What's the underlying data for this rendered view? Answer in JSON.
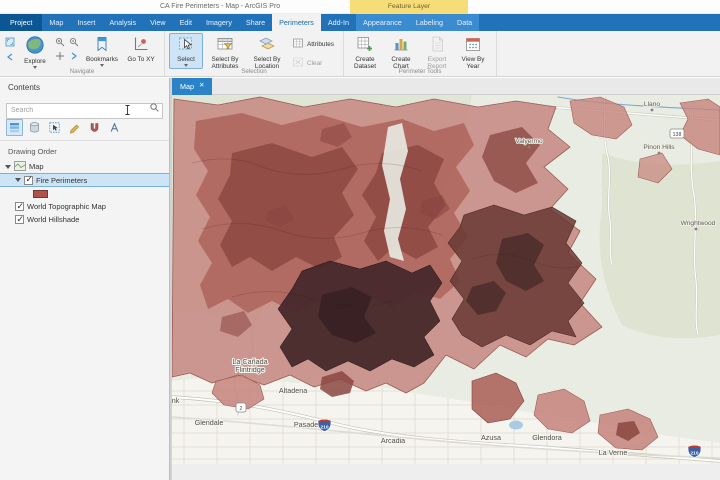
{
  "window": {
    "title": "CA Fire Perimeters - Map - ArcGIS Pro",
    "contextual_group": "Feature Layer"
  },
  "tabs": {
    "items": [
      "Project",
      "Map",
      "Insert",
      "Analysis",
      "View",
      "Edit",
      "Imagery",
      "Share",
      "Perimeters",
      "Add-In",
      "Appearance",
      "Labeling",
      "Data"
    ],
    "active": "Perimeters"
  },
  "ribbon": {
    "navigate": {
      "label": "Navigate",
      "explore": "Explore",
      "bookmarks": "Bookmarks",
      "go_to_xy": "Go To XY"
    },
    "selection": {
      "label": "Selection",
      "select": "Select",
      "select_by_attributes": "Select By Attributes",
      "select_by_location": "Select By Location",
      "attributes": "Attributes",
      "clear": "Clear"
    },
    "perimeter_tools": {
      "label": "Perimeter Tools",
      "create_dataset": "Create Dataset",
      "create_chart": "Create Chart",
      "export_report": "Export Report",
      "view_by_year": "View By Year"
    }
  },
  "contents": {
    "title": "Contents",
    "search_placeholder": "Search",
    "drawing_order": "Drawing Order",
    "map_node": "Map",
    "layers": [
      "Fire Perimeters",
      "World Topographic Map",
      "World Hillshade"
    ]
  },
  "mapview": {
    "tab": "Map",
    "close_glyph": "✕",
    "places": [
      "Llano",
      "Pinon Hills",
      "Valyermo",
      "Wrightwood",
      "La Cañada",
      "Flintridge",
      "Altadena",
      "Pasadena",
      "Glendale",
      "Burbank",
      "Arcadia",
      "Azusa",
      "Glendora",
      "La Verne"
    ],
    "shields": [
      "2",
      "210",
      "210",
      "138"
    ],
    "colors": {
      "fire_light": "#c5837c",
      "fire_medium": "#a95e55",
      "fire_dark": "#8a4640",
      "fire_darker": "#683833",
      "fire_darkest": "#45282a",
      "fire_deep": "#2e1a1c",
      "basemap": "#e9ece2",
      "urban": "#f5f4ee",
      "veg": "#d9e1ca",
      "water": "#a9cbe4",
      "swatch": "#b2514b"
    }
  }
}
